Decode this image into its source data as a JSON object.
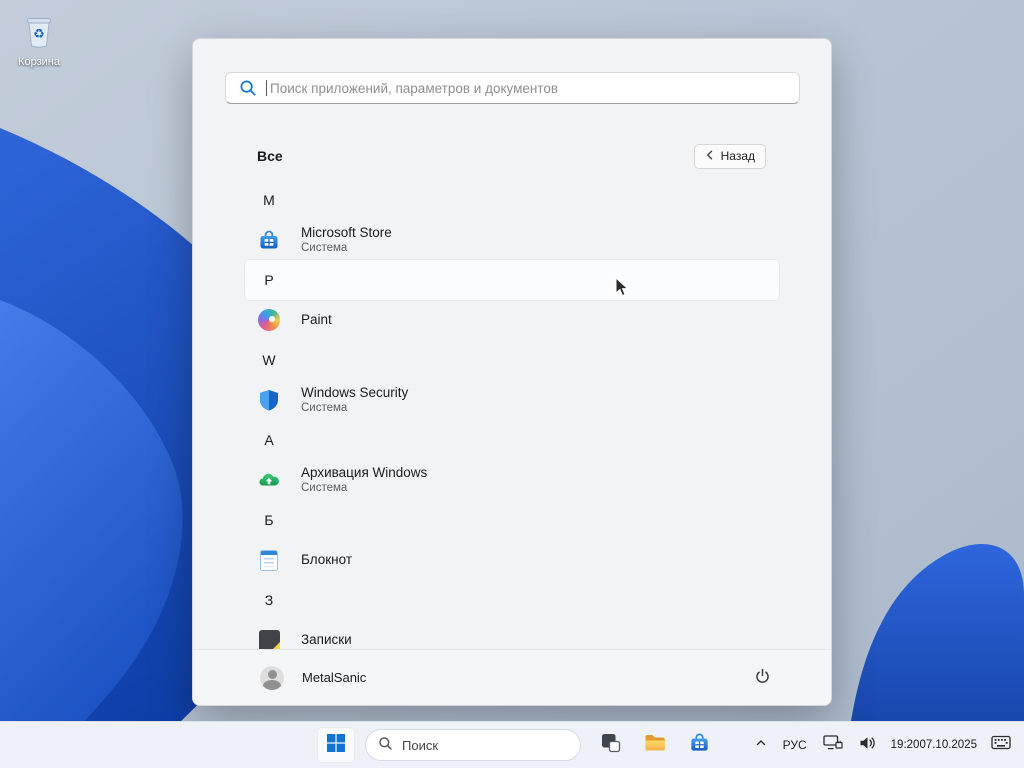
{
  "desktop": {
    "recycle_bin": {
      "label": "Корзина",
      "glyph": "♻"
    }
  },
  "start_menu": {
    "search": {
      "placeholder": "Поиск приложений, параметров и документов",
      "value": ""
    },
    "header": {
      "title": "Все",
      "back_label": "Назад"
    },
    "sections": [
      {
        "letter": "M",
        "app": {
          "name": "Microsoft Store",
          "subtitle": "Система",
          "icon": "microsoft-store-icon"
        }
      },
      {
        "letter": "P",
        "hovered": true,
        "app": {
          "name": "Paint",
          "icon": "paint-icon"
        }
      },
      {
        "letter": "W",
        "app": {
          "name": "Windows Security",
          "subtitle": "Система",
          "icon": "windows-security-icon"
        }
      },
      {
        "letter": "А",
        "app": {
          "name": "Архивация Windows",
          "subtitle": "Система",
          "icon": "windows-backup-icon"
        }
      },
      {
        "letter": "Б",
        "app": {
          "name": "Блокнот",
          "icon": "notepad-icon"
        }
      },
      {
        "letter": "З",
        "app": {
          "name": "Записки",
          "icon": "sticky-notes-icon"
        }
      }
    ],
    "user": {
      "name": "MetalSanic"
    }
  },
  "taskbar": {
    "search_label": "Поиск",
    "tray": {
      "language": "РУС",
      "time": "19:20",
      "date": "07.10.2025"
    }
  },
  "colors": {
    "accent": "#0078d4",
    "wallpaper_base": "#b9c4d3",
    "wallpaper_bloom": "#1c4fc0",
    "menu_background": "#f2f3f5"
  }
}
